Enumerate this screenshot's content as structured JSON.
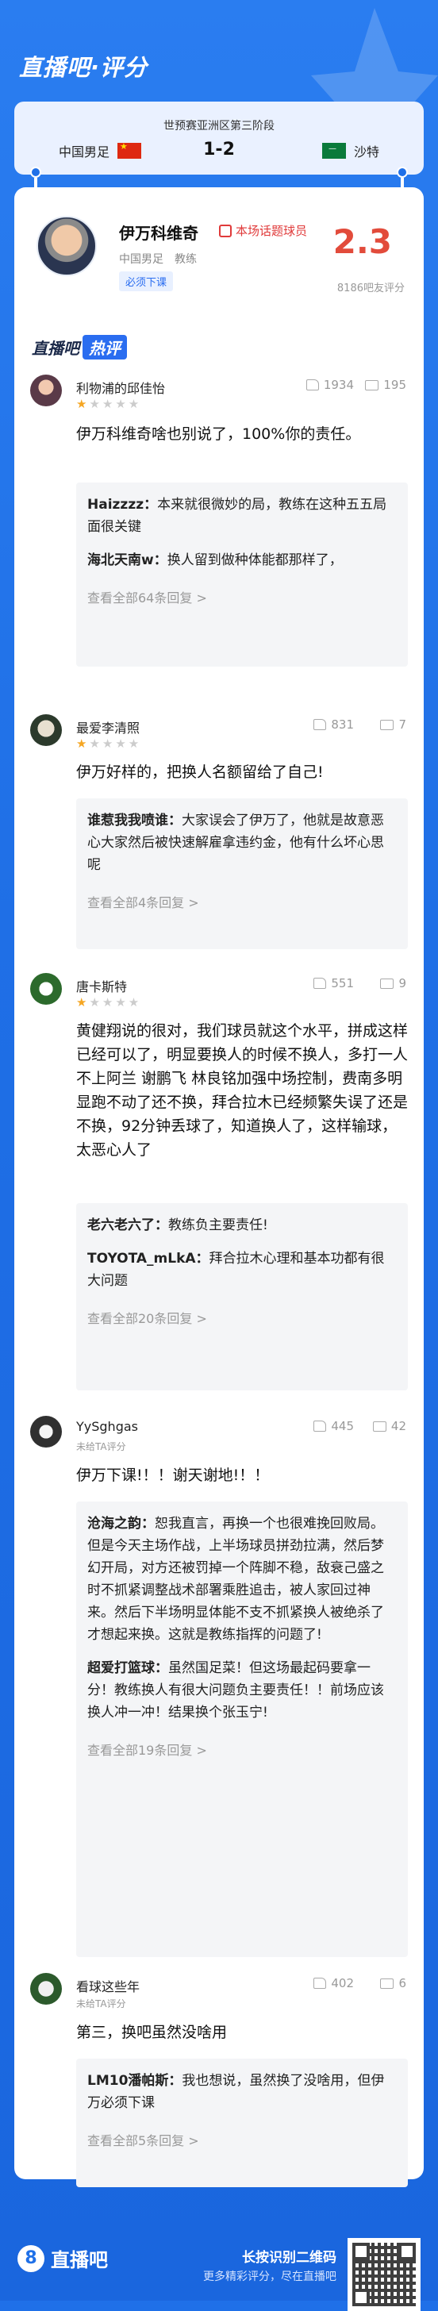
{
  "header": {
    "brand": "直播吧·评分"
  },
  "match": {
    "stage": "世预赛亚洲区第三阶段",
    "score": "1-2",
    "home_team": "中国男足",
    "away_team": "沙特"
  },
  "player": {
    "name": "伊万科维奇",
    "topic_tag": "本场话题球员",
    "team": "中国男足",
    "role": "教练",
    "label_tag": "必须下课",
    "rating": "2.3",
    "rating_count": "8186吧友评分"
  },
  "hot_section": {
    "brand": "直播吧",
    "tag": "热评"
  },
  "comments": [
    {
      "user": "利物浦的邱佳怡",
      "stars": 1,
      "likes": "1934",
      "replies_count": "195",
      "text": "伊万科维奇啥也别说了，100%你的责任。",
      "replies": [
        {
          "user": "Haizzzz：",
          "text": "本来就很微妙的局，教练在这种五五局面很关键"
        },
        {
          "user": "海北天南w：",
          "text": "换人留到做种体能都那样了，"
        }
      ],
      "more": "查看全部64条回复 >"
    },
    {
      "user": "最爱李清照",
      "stars": 1,
      "likes": "831",
      "replies_count": "7",
      "text": "伊万好样的，把换人名额留给了自己!",
      "replies": [
        {
          "user": "谁惹我我喷谁：",
          "text": "大家误会了伊万了，他就是故意恶心大家然后被快速解雇拿违约金，他有什么坏心思呢"
        }
      ],
      "more": "查看全部4条回复 >"
    },
    {
      "user": "唐卡斯特",
      "stars": 1,
      "likes": "551",
      "replies_count": "9",
      "text": "黄健翔说的很对，我们球员就这个水平，拼成这样已经可以了，明显要换人的时候不换人，多打一人不上阿兰 谢鹏飞 林良铭加强中场控制，费南多明显跑不动了还不换，拜合拉木已经频繁失误了还是不换，92分钟丢球了，知道换人了，这样输球，太恶心人了",
      "replies": [
        {
          "user": "老六老六了：",
          "text": "教练负主要责任!"
        },
        {
          "user": "TOYOTA_mLkA：",
          "text": "拜合拉木心理和基本功都有很大问题"
        }
      ],
      "more": "查看全部20条回复 >"
    },
    {
      "user": "YySghgas",
      "sub": "未给TA评分",
      "likes": "445",
      "replies_count": "42",
      "text": "伊万下课!！！谢天谢地!！！",
      "replies": [
        {
          "user": "沧海之韵：",
          "text": "恕我直言，再换一个也很难挽回败局。但是今天主场作战，上半场球员拼劲拉满，然后梦幻开局，对方还被罚掉一个阵脚不稳，敌衰己盛之时不抓紧调整战术部署乘胜追击，被人家回过神来。然后下半场明显体能不支不抓紧换人被绝杀了才想起来换。这就是教练指挥的问题了!"
        },
        {
          "user": "超爱打篮球：",
          "text": "虽然国足菜！但这场最起码要拿一分！教练换人有很大问题负主要责任！！前场应该换人冲一冲！结果换个张玉宁!"
        }
      ],
      "more": "查看全部19条回复 >"
    },
    {
      "user": "看球这些年",
      "sub": "未给TA评分",
      "likes": "402",
      "replies_count": "6",
      "text": "第三，换吧虽然没啥用",
      "replies": [
        {
          "user": "LM10潘帕斯：",
          "text": "我也想说，虽然换了没啥用，但伊万必须下课"
        }
      ],
      "more": "查看全部5条回复 >"
    }
  ],
  "footer": {
    "logo": "直播吧",
    "scan_text": "长按识别二维码",
    "more_text": "更多精彩评分，尽在直播吧"
  },
  "colors": {
    "primary": "#1f70e8",
    "rating": "#e24b3b",
    "star": "#f5a623"
  }
}
